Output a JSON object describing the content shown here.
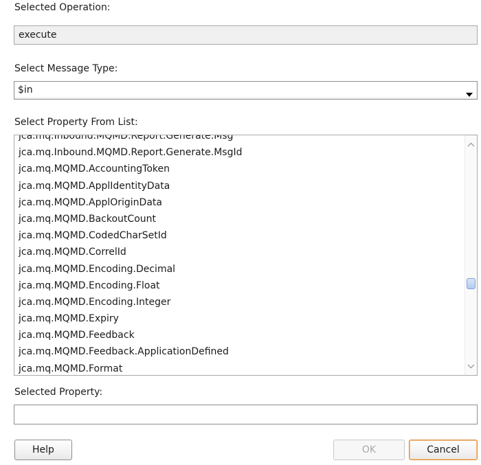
{
  "operation": {
    "label": "Selected Operation:",
    "value": "execute"
  },
  "message_type": {
    "label": "Select Message Type:",
    "value": "$in",
    "dropdown_icon": "chevron-down-icon"
  },
  "property_list": {
    "label": "Select Property From List:",
    "items": [
      "jca.mq.Inbound.MQMD.Report.Generate.MsgId",
      "jca.mq.MQMD.AccountingToken",
      "jca.mq.MQMD.ApplIdentityData",
      "jca.mq.MQMD.ApplOriginData",
      "jca.mq.MQMD.BackoutCount",
      "jca.mq.MQMD.CodedCharSetId",
      "jca.mq.MQMD.CorrelId",
      "jca.mq.MQMD.Encoding.Decimal",
      "jca.mq.MQMD.Encoding.Float",
      "jca.mq.MQMD.Encoding.Integer",
      "jca.mq.MQMD.Expiry",
      "jca.mq.MQMD.Feedback",
      "jca.mq.MQMD.Feedback.ApplicationDefined",
      "jca.mq.MQMD.Format"
    ]
  },
  "selected_property": {
    "label": "Selected Property:",
    "value": ""
  },
  "buttons": {
    "help": "Help",
    "ok": "OK",
    "cancel": "Cancel"
  }
}
